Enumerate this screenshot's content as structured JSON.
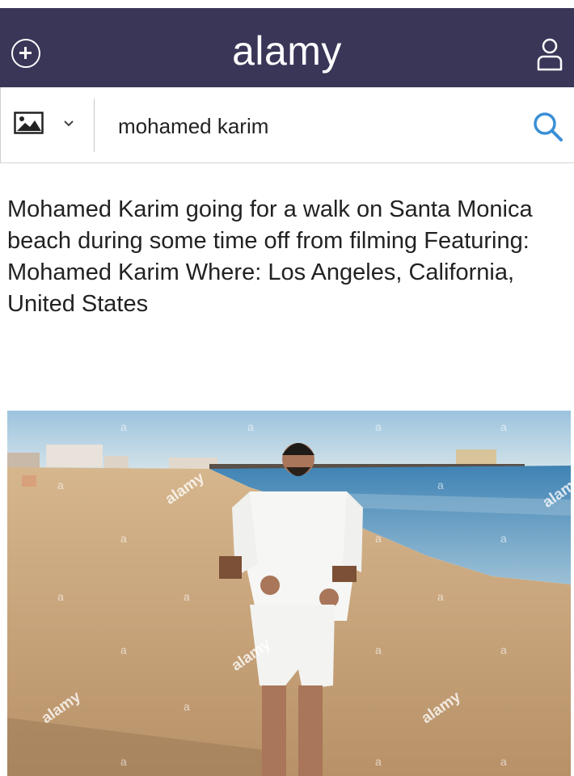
{
  "header": {
    "logo": "alamy",
    "add_icon": "plus-circle-icon",
    "user_icon": "user-icon",
    "bg_color": "#3a3658"
  },
  "search": {
    "type_icon": "image-icon",
    "dropdown_icon": "chevron-down-icon",
    "query": "mohamed karim",
    "search_icon": "search-icon",
    "accent_color": "#3a8fd6"
  },
  "caption": "Mohamed Karim going for a walk on Santa Monica beach during some time off from filming Featuring: Mohamed Karim Where: Los Angeles, California, United States",
  "photo": {
    "watermark": "alamy",
    "watermark_small": "a"
  }
}
